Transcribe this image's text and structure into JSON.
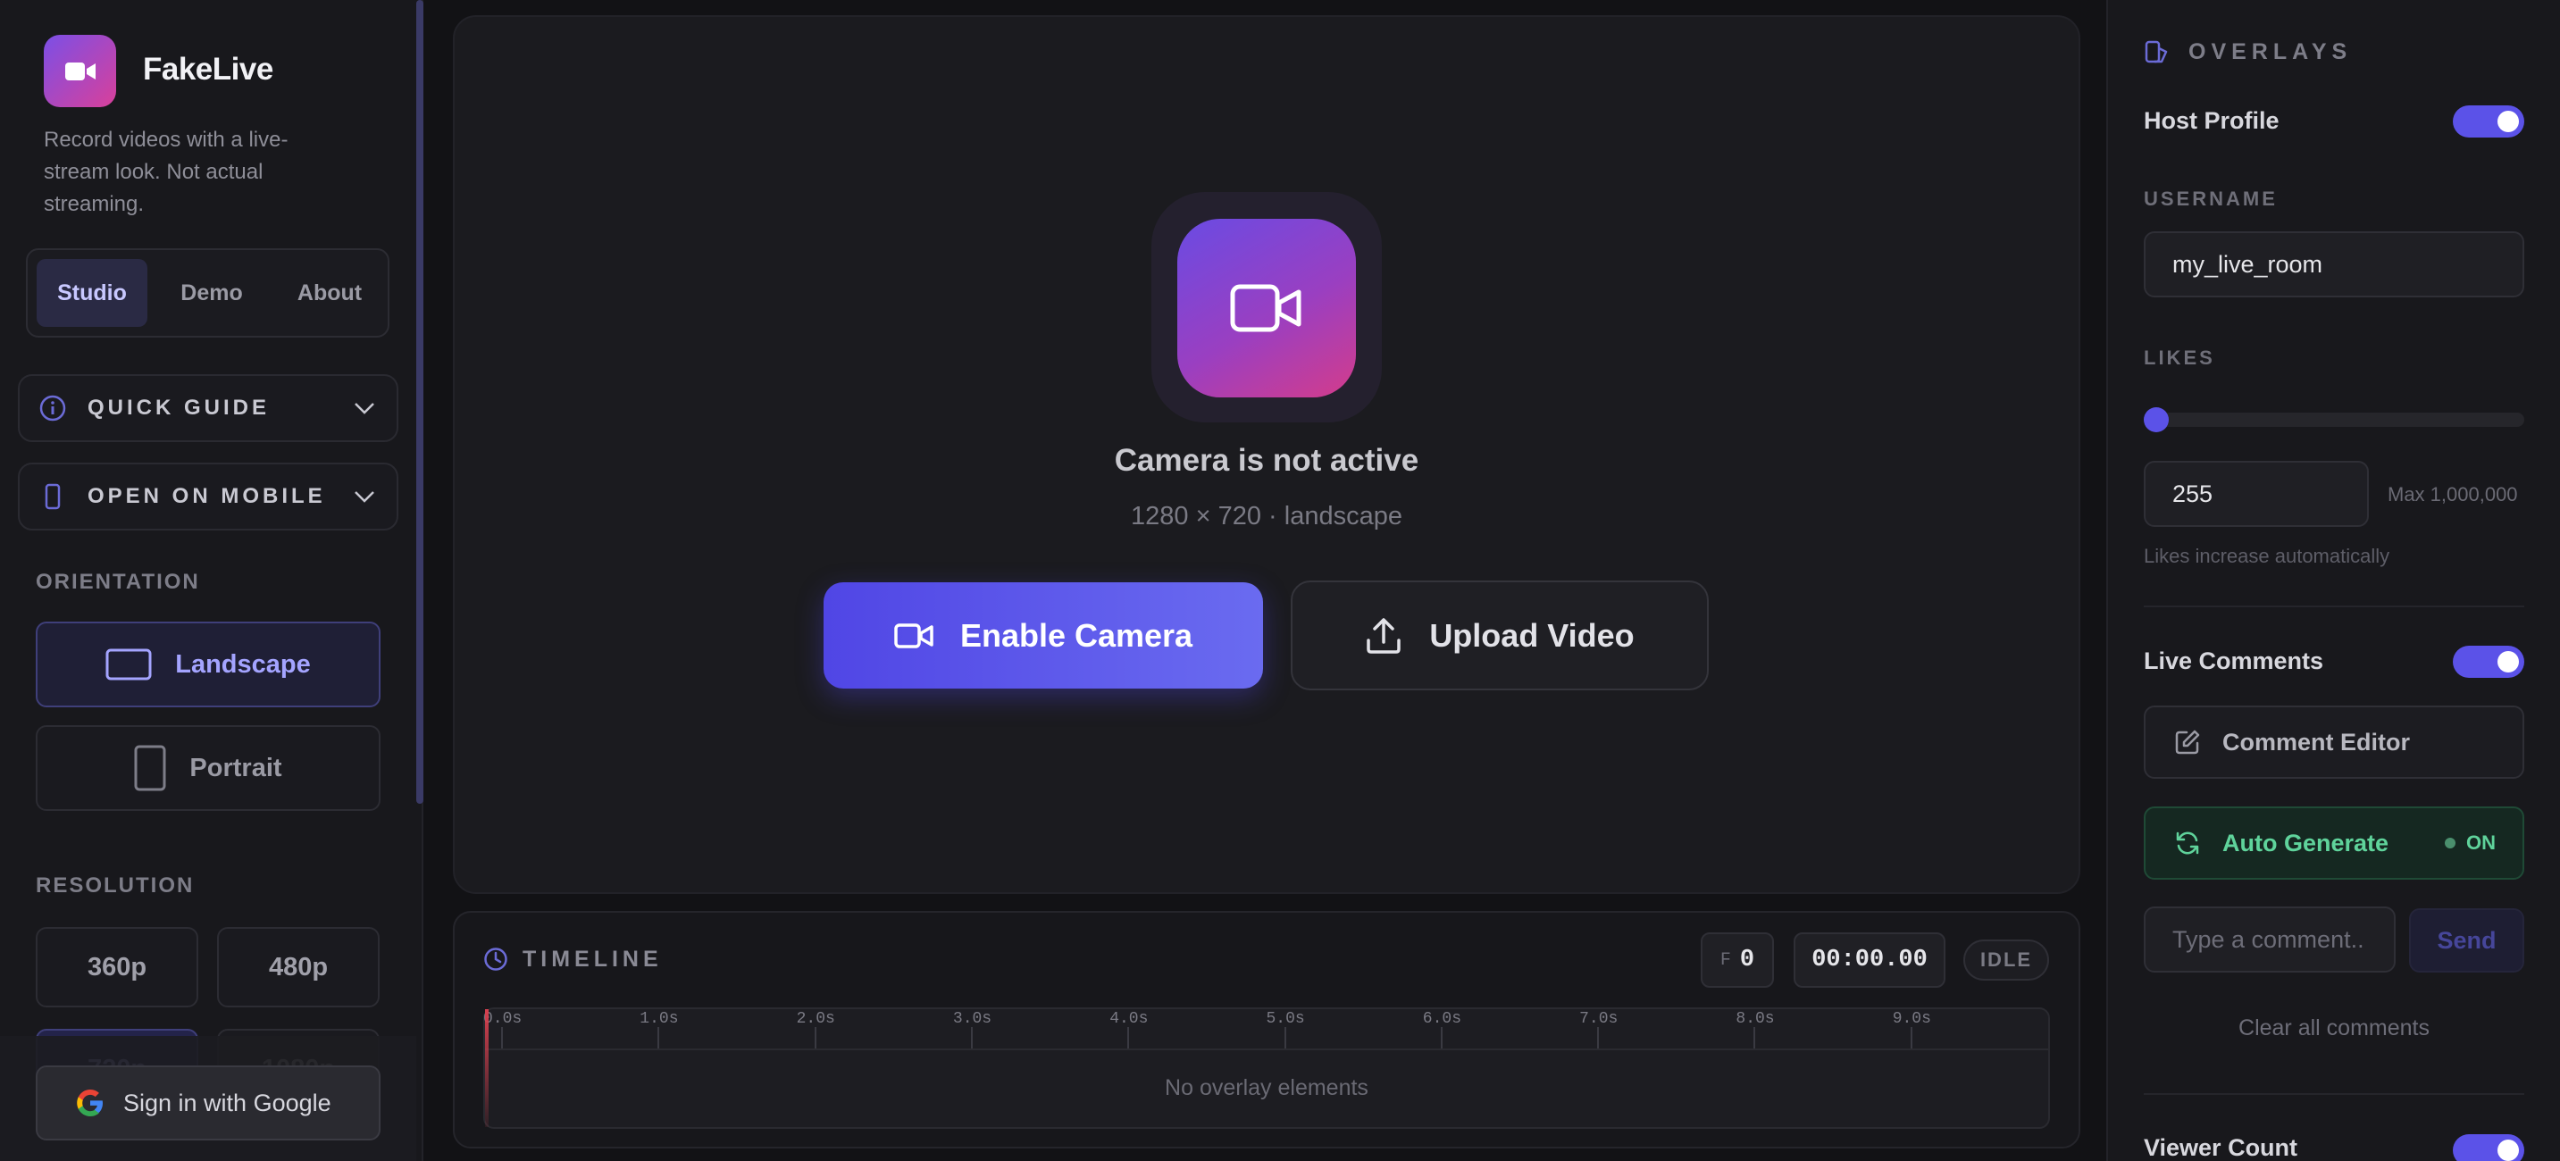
{
  "app": {
    "name": "FakeLive",
    "tagline": "Record videos with a live-stream look. Not actual streaming."
  },
  "nav_tabs": [
    {
      "label": "Studio",
      "active": true
    },
    {
      "label": "Demo",
      "active": false
    },
    {
      "label": "About",
      "active": false
    }
  ],
  "accordions": {
    "quick_guide": "QUICK GUIDE",
    "open_on_mobile": "OPEN ON MOBILE"
  },
  "orientation": {
    "label": "ORIENTATION",
    "options": [
      {
        "label": "Landscape",
        "active": true
      },
      {
        "label": "Portrait",
        "active": false
      }
    ]
  },
  "resolution": {
    "label": "RESOLUTION",
    "options": [
      {
        "label": "360p",
        "active": false
      },
      {
        "label": "480p",
        "active": false
      },
      {
        "label": "720p",
        "active": true
      },
      {
        "label": "1080p",
        "active": false
      }
    ]
  },
  "signin": {
    "label": "Sign in with Google"
  },
  "stage": {
    "status_title": "Camera is not active",
    "status_sub": "1280 × 720 · landscape",
    "enable_label": "Enable Camera",
    "upload_label": "Upload Video"
  },
  "timeline": {
    "label": "TIMELINE",
    "frame_prefix": "F",
    "frame_value": "0",
    "time": "00:00.00",
    "state": "IDLE",
    "ticks": [
      "0.0s",
      "1.0s",
      "2.0s",
      "3.0s",
      "4.0s",
      "5.0s",
      "6.0s",
      "7.0s",
      "8.0s",
      "9.0s"
    ],
    "empty_text": "No overlay elements"
  },
  "overlays": {
    "title": "OVERLAYS",
    "host_profile": {
      "label": "Host Profile",
      "enabled": true
    },
    "username": {
      "label": "USERNAME",
      "value": "my_live_room"
    },
    "likes": {
      "label": "LIKES",
      "value": "255",
      "max_text": "Max 1,000,000",
      "hint": "Likes increase automatically",
      "level_fraction": 0.000255
    },
    "live_comments": {
      "label": "Live Comments",
      "enabled": true
    },
    "comment_editor": "Comment Editor",
    "auto_generate": {
      "label": "Auto Generate",
      "state": "ON"
    },
    "comment_input": {
      "placeholder": "Type a comment..",
      "send_label": "Send"
    },
    "clear_label": "Clear all comments",
    "viewer_count": {
      "label": "Viewer Count",
      "enabled": true
    }
  },
  "colors": {
    "accent": "#5b52e8",
    "brand_gradient_start": "#7b4fe6",
    "brand_gradient_end": "#d9409a",
    "success": "#5fd39b",
    "background": "#121215"
  }
}
